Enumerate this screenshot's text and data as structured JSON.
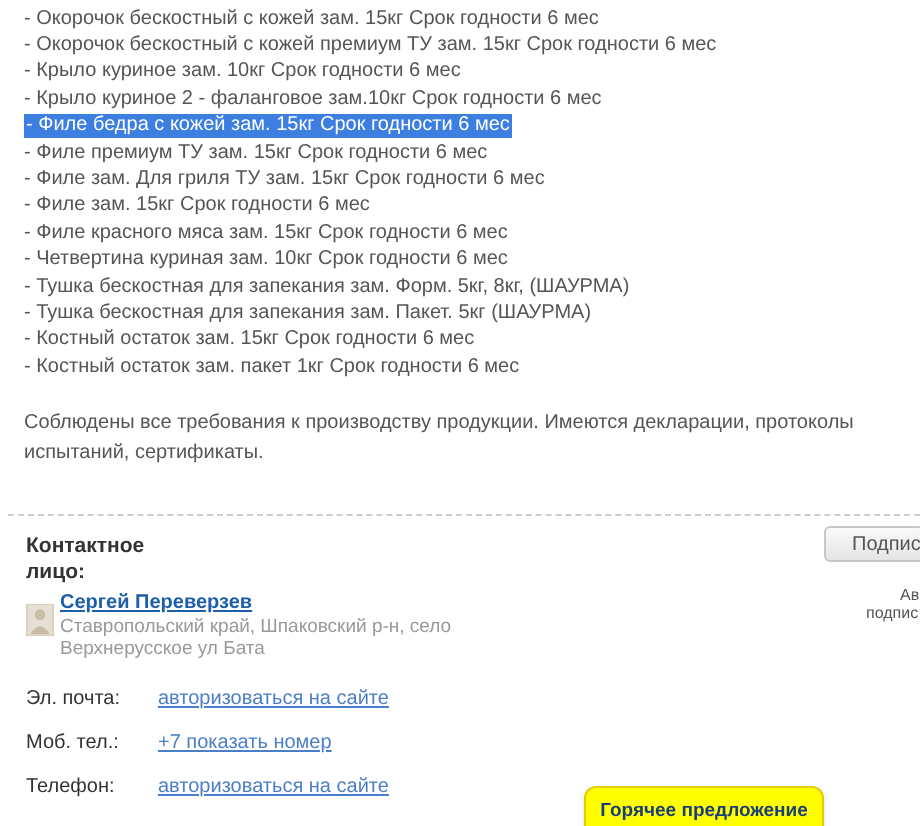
{
  "products": [
    {
      "text": "- Окорочок бескостный с кожей зам. 15кг Срок годности 6 мес",
      "selected": false
    },
    {
      "text": "- Окорочок бескостный с кожей премиум ТУ зам. 15кг Срок годности 6 мес",
      "selected": false
    },
    {
      "text": "- Крыло куриное зам. 10кг Срок годности 6 мес",
      "selected": false
    },
    {
      "text": "- Крыло куриное 2 - фаланговое зам.10кг Срок годности 6 мес",
      "selected": false
    },
    {
      "text": "- Филе бедра с кожей зам. 15кг Срок годности 6 мес",
      "selected": true
    },
    {
      "text": "- Филе премиум ТУ зам. 15кг Срок годности 6 мес",
      "selected": false
    },
    {
      "text": "- Филе зам. Для гриля ТУ зам. 15кг Срок годности 6 мес",
      "selected": false
    },
    {
      "text": "- Филе зам. 15кг Срок годности 6 мес",
      "selected": false
    },
    {
      "text": "- Филе красного мяса зам. 15кг Срок годности 6 мес",
      "selected": false
    },
    {
      "text": "- Четвертина куриная зам. 10кг Срок годности 6 мес",
      "selected": false
    },
    {
      "text": "- Тушка бескостная для запекания зам. Форм. 5кг, 8кг, (ШАУРМА)",
      "selected": false
    },
    {
      "text": "- Тушка бескостная для запекания зам. Пакет. 5кг (ШАУРМА)",
      "selected": false
    },
    {
      "text": "- Костный остаток зам. 15кг Срок годности 6 мес",
      "selected": false
    },
    {
      "text": "- Костный остаток зам. пакет 1кг Срок годности 6 мес",
      "selected": false
    }
  ],
  "description": "Соблюдены все требования к производству продукции. Имеются декларации, протоколы испытаний, сертификаты.",
  "contact": {
    "label": "Контактное лицо:",
    "subscribe_button": "Подпис",
    "side_note": [
      "Ав",
      "подпис"
    ],
    "name": "Сергей Переверзев",
    "address": "Ставропольский край, Шпаковский р-н, село Верхнерусское ул Бата",
    "rows": [
      {
        "label": "Эл. почта:",
        "value": "авторизоваться на сайте"
      },
      {
        "label": "Моб. тел.:",
        "value": "+7 показать номер"
      },
      {
        "label": "Телефон:",
        "value": "авторизоваться на сайте"
      }
    ]
  },
  "hot_offer": "Горячее предложение"
}
